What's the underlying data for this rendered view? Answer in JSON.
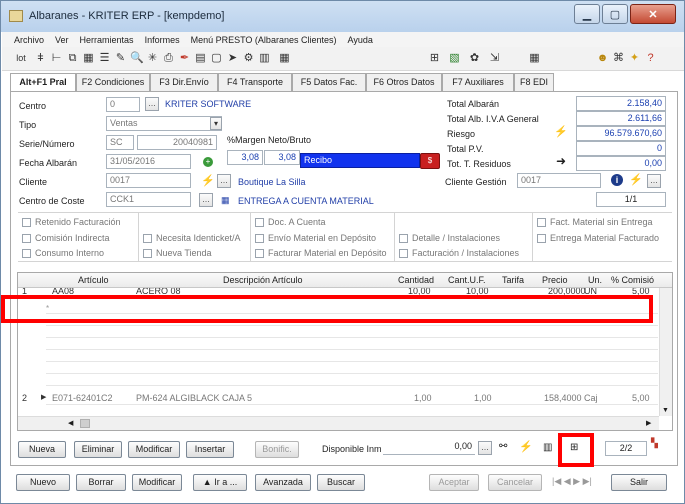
{
  "window": {
    "title": "Albaranes - KRITER ERP -  [kempdemo]",
    "min_icon": "minimize-icon",
    "max_icon": "maximize-icon",
    "close_icon": "close-icon"
  },
  "menu": [
    "Archivo",
    "Ver",
    "Herramientas",
    "Informes",
    "Menú PRESTO (Albaranes Clientes)",
    "Ayuda"
  ],
  "tabs": [
    {
      "label": "Alt+F1 Pral",
      "active": true
    },
    {
      "label": "F2 Condiciones"
    },
    {
      "label": "F3 Dir.Envío"
    },
    {
      "label": "F4 Transporte"
    },
    {
      "label": "F5 Datos Fac."
    },
    {
      "label": "F6 Otros Datos"
    },
    {
      "label": "F7 Auxiliares"
    },
    {
      "label": "F8 EDI"
    }
  ],
  "form": {
    "centro_label": "Centro",
    "centro_value": "0",
    "centro_name": "KRITER SOFTWARE",
    "tipo_label": "Tipo",
    "tipo_value": "Ventas",
    "serie_label": "Serie/Número",
    "serie_value": "SC",
    "numero_value": "20040981",
    "fecha_label": "Fecha Albarán",
    "fecha_value": "31/05/2016",
    "cliente_label": "Cliente",
    "cliente_value": "0017",
    "cliente_name": "Boutique La Silla",
    "coste_label": "Centro de Coste",
    "coste_value": "CCK1",
    "coste_name": "ENTREGA A CUENTA MATERIAL",
    "margen_label": "%Margen Neto/Bruto",
    "margen_neto": "3,08",
    "margen_bruto": "3,08",
    "recibo_value": "Recibo",
    "cliente_gestion_label": "Cliente Gestión",
    "cliente_gestion_value": "0017",
    "page_counter": "1/1"
  },
  "totals": [
    {
      "label": "Total Albarán",
      "value": "2.158,40"
    },
    {
      "label": "Total Alb. I.V.A General",
      "value": "2.611,66"
    },
    {
      "label": "Riesgo",
      "value": "96.579.670,60"
    },
    {
      "label": "Total P.V.",
      "value": "0"
    },
    {
      "label": "Tot. T. Residuos",
      "value": "0,00"
    }
  ],
  "checkboxes": [
    [
      "Retenido Facturación",
      "Comisión Indirecta",
      "Consumo Interno"
    ],
    [
      "",
      "Necesita Identicket/A",
      "Nueva Tienda"
    ],
    [
      "Doc. A Cuenta",
      "Envío Material en Depósito",
      "Facturar Material en Depósito"
    ],
    [
      "",
      "Detalle / Instalaciones",
      "Facturación / Instalaciones"
    ],
    [
      "Fact. Material sin Entrega",
      "Entrega Material Facturado",
      ""
    ]
  ],
  "grid": {
    "headers": [
      "Artículo",
      "Descripción Artículo",
      "Cantidad",
      "Cant.U.F.",
      "Tarifa",
      "Precio",
      "Un.",
      "% Comisió"
    ],
    "rows": [
      {
        "n": "1",
        "articulo": "AA08",
        "descripcion": "ACERO 08",
        "cantidad": "10,00",
        "cantuf": "10,00",
        "tarifa": "",
        "precio": "200,0000",
        "un": "UN",
        "comision": "5,00"
      },
      {
        "n": "2",
        "articulo": "E071-62401C2",
        "descripcion": "PM-624 ALGIBLACK CAJA 5",
        "cantidad": "1,00",
        "cantuf": "1,00",
        "tarifa": "",
        "precio": "158,4000",
        "un": "Caj",
        "comision": "5,00"
      }
    ],
    "new_row_marker": "*"
  },
  "line_buttons": [
    "Nueva",
    "Eliminar",
    "Modificar",
    "Insertar",
    "Bonific."
  ],
  "disponible_label": "Disponible Inm",
  "disponible_value": "0,00",
  "line_counter": "2/2",
  "bottom_buttons": [
    "Nuevo",
    "Borrar",
    "Modificar",
    "Ir a ...",
    "Avanzada",
    "Buscar",
    "Aceptar",
    "Cancelar",
    "Salir"
  ]
}
